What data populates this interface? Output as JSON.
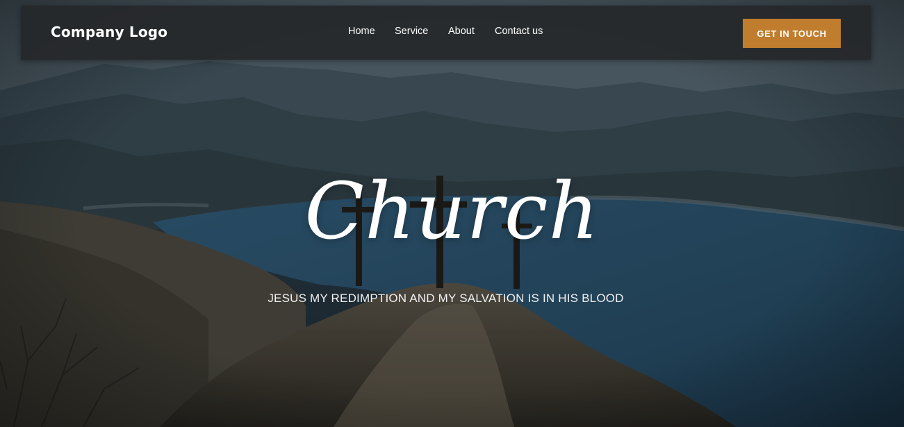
{
  "header": {
    "logo": "Company Logo",
    "nav": [
      {
        "label": "Home"
      },
      {
        "label": "Service"
      },
      {
        "label": "About"
      },
      {
        "label": "Contact us"
      }
    ],
    "cta_label": "GET IN TOUCH"
  },
  "hero": {
    "title": "Church",
    "subtitle": "JESUS MY REDIMPTION AND MY SALVATION IS IN HIS BLOOD"
  },
  "colors": {
    "navbar_bg": "#26282a",
    "cta_bg": "#c07d2e",
    "text": "#ffffff",
    "lake": "#2f5a78"
  }
}
